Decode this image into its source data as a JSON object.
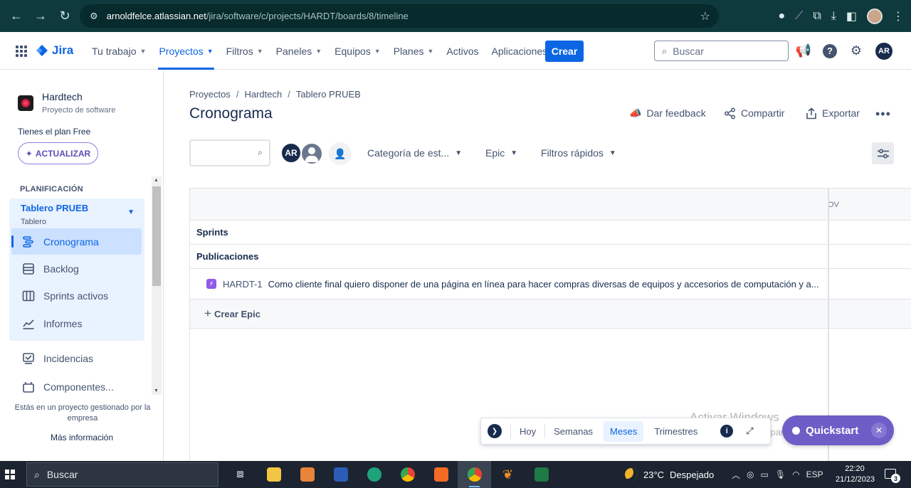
{
  "browser": {
    "url_host": "arnoldfelce.atlassian.net",
    "url_path": "/jira/software/c/projects/HARDT/boards/8/timeline"
  },
  "nav": {
    "logo": "Jira",
    "items": [
      {
        "label": "Tu trabajo",
        "chevron": true
      },
      {
        "label": "Proyectos",
        "chevron": true,
        "active": true
      },
      {
        "label": "Filtros",
        "chevron": true
      },
      {
        "label": "Paneles",
        "chevron": true
      },
      {
        "label": "Equipos",
        "chevron": true
      },
      {
        "label": "Planes",
        "chevron": true
      },
      {
        "label": "Activos",
        "chevron": false
      },
      {
        "label": "Aplicaciones",
        "chevron": true
      }
    ],
    "create_label": "Crear",
    "search_placeholder": "Buscar",
    "avatar_initials": "AR"
  },
  "sidebar": {
    "project_name": "Hardtech",
    "project_type": "Proyecto de software",
    "plan_text": "Tienes el plan Free",
    "upgrade_label": "ACTUALIZAR",
    "section_label": "PLANIFICACIÓN",
    "board_name": "Tablero PRUEB",
    "board_type": "Tablero",
    "board_items": [
      {
        "label": "Cronograma",
        "icon": "timeline-icon",
        "active": true
      },
      {
        "label": "Backlog",
        "icon": "backlog-icon"
      },
      {
        "label": "Sprints activos",
        "icon": "board-columns-icon"
      },
      {
        "label": "Informes",
        "icon": "chart-line-icon"
      }
    ],
    "other_items": [
      {
        "label": "Incidencias",
        "icon": "issues-icon"
      },
      {
        "label": "Componentes...",
        "icon": "components-icon"
      }
    ],
    "footnote": "Estás en un proyecto gestionado por la empresa",
    "more_info": "Más información"
  },
  "main": {
    "breadcrumbs": [
      "Proyectos",
      "Hardtech",
      "Tablero PRUEB"
    ],
    "title": "Cronograma",
    "actions": {
      "feedback": "Dar feedback",
      "share": "Compartir",
      "export": "Exportar"
    },
    "avatar_initials": "AR",
    "filters": {
      "category": "Categoría de est...",
      "epic": "Epic",
      "quick": "Filtros rápidos"
    }
  },
  "timeline": {
    "month_label": "OV",
    "rows": {
      "sprints": "Sprints",
      "releases": "Publicaciones"
    },
    "issue": {
      "key": "HARDT-1",
      "summary": "Como cliente final quiero disponer de una página en línea para hacer compras diversas de equipos y accesorios de computación y a..."
    },
    "create_epic": "Crear Epic"
  },
  "view_bar": {
    "today": "Hoy",
    "weeks": "Semanas",
    "months": "Meses",
    "quarters": "Trimestres",
    "selected": "Meses"
  },
  "overlay": {
    "watermark_title": "Activar Windows",
    "watermark_sub": "Ve a Configuración para activar Windows.",
    "quickstart": "Quickstart"
  },
  "taskbar": {
    "search": "Buscar",
    "weather_temp": "23°C",
    "weather_text": "Despejado",
    "lang": "ESP",
    "time": "22:20",
    "date": "21/12/2023",
    "notifications": "3"
  }
}
